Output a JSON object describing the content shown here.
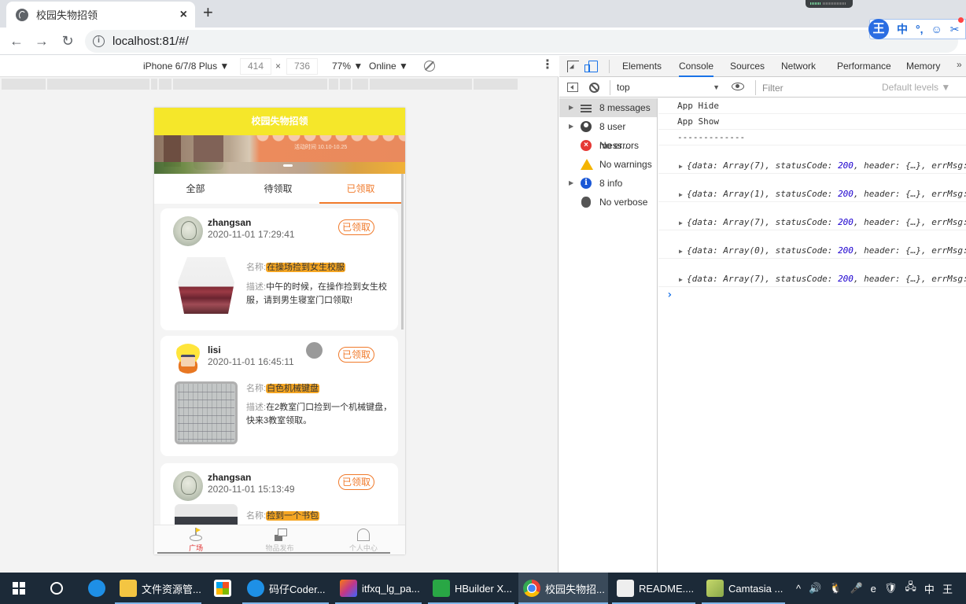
{
  "browser": {
    "tab_title": "校园失物招领",
    "tab_close": "×",
    "new_tab": "+",
    "back": "←",
    "forward": "→",
    "reload": "↻",
    "info_icon": "i",
    "url": "localhost:81/#/"
  },
  "ime_toolbar": {
    "logo": "王",
    "items": [
      "中",
      "°,",
      "☺",
      "✂"
    ]
  },
  "device_toolbar": {
    "device": "iPhone 6/7/8 Plus ▼",
    "width": "414",
    "times": "×",
    "height": "736",
    "zoom": "77% ▼",
    "network": "Online ▼",
    "more": "⋮"
  },
  "app": {
    "header_title": "校园失物招领",
    "banner_text": "活动时间  10.10-10.25",
    "filter_tabs": [
      {
        "label": "全部",
        "active": false
      },
      {
        "label": "待领取",
        "active": false
      },
      {
        "label": "已领取",
        "active": true
      }
    ],
    "name_label": "名称:",
    "desc_label": "描述:",
    "posts": [
      {
        "user": "zhangsan",
        "time": "2020-11-01 17:29:41",
        "status": "已领取",
        "name": "在操场捡到女生校服",
        "desc": "中午的时候，在操作捡到女生校服，请到男生寝室门口领取!"
      },
      {
        "user": "lisi",
        "time": "2020-11-01 16:45:11",
        "status": "已领取",
        "name": "白色机械键盘",
        "desc": "在2教室门口捡到一个机械键盘，快来3教室领取。"
      },
      {
        "user": "zhangsan",
        "time": "2020-11-01 15:13:49",
        "status": "已领取",
        "name": "捡到一个书包",
        "desc": ""
      }
    ],
    "bottom_tabs": [
      {
        "label": "广场",
        "active": true
      },
      {
        "label": "物品发布",
        "active": false
      },
      {
        "label": "个人中心",
        "active": false
      }
    ],
    "accent_color": "#f07a2b",
    "header_color": "#f5e72a"
  },
  "devtools": {
    "tabs": [
      {
        "label": "Elements",
        "active": false
      },
      {
        "label": "Console",
        "active": true
      },
      {
        "label": "Sources",
        "active": false
      },
      {
        "label": "Network",
        "active": false
      },
      {
        "label": "Performance",
        "active": false
      },
      {
        "label": "Memory",
        "active": false
      }
    ],
    "more_tabs": "»",
    "context": "top",
    "context_arrow": "▼",
    "filter_placeholder": "Filter",
    "levels": "Default levels ▼",
    "sidebar": [
      {
        "label": "8 messages",
        "icon": "list-icon",
        "expandable": true
      },
      {
        "label": "8 user mess...",
        "icon": "user-icon",
        "expandable": true
      },
      {
        "label": "No errors",
        "icon": "error-icon",
        "expandable": false
      },
      {
        "label": "No warnings",
        "icon": "warning-icon",
        "expandable": false
      },
      {
        "label": "8 info",
        "icon": "info-icon",
        "expandable": true
      },
      {
        "label": "No verbose",
        "icon": "bug-icon",
        "expandable": false
      }
    ],
    "logs": [
      {
        "text": "App Hide"
      },
      {
        "text": "App Show"
      },
      {
        "text": "-------------"
      }
    ],
    "objects": [
      {
        "pre": "{data: Array(7), statusCode: ",
        "code": "200",
        "post": ", header: {…}, errMsg:"
      },
      {
        "pre": "{data: Array(1), statusCode: ",
        "code": "200",
        "post": ", header: {…}, errMsg:"
      },
      {
        "pre": "{data: Array(7), statusCode: ",
        "code": "200",
        "post": ", header: {…}, errMsg:"
      },
      {
        "pre": "{data: Array(0), statusCode: ",
        "code": "200",
        "post": ", header: {…}, errMsg:"
      },
      {
        "pre": "{data: Array(7), statusCode: ",
        "code": "200",
        "post": ", header: {…}, errMsg:"
      }
    ],
    "prompt": "›"
  },
  "taskbar": {
    "apps": [
      {
        "label": "文件资源管...",
        "icon": "folder-icon",
        "color": "#f4c542"
      },
      {
        "label": "",
        "icon": "store-icon",
        "color": "#ffffff"
      },
      {
        "label": "码仔Coder...",
        "icon": "ie-icon",
        "color": "#1e90e6"
      },
      {
        "label": "itfxq_lg_pa...",
        "icon": "intellij-icon",
        "color": "#c2378a"
      },
      {
        "label": "HBuilder X...",
        "icon": "hbuilder-icon",
        "color": "#29a745"
      },
      {
        "label": "校园失物招...",
        "icon": "chrome-icon",
        "color": "#e8453c"
      },
      {
        "label": "README....",
        "icon": "typora-icon",
        "color": "#eeeeee"
      },
      {
        "label": "Camtasia ...",
        "icon": "camtasia-icon",
        "color": "#a5c25a"
      }
    ],
    "tray": [
      "^",
      "🔊",
      "🐧",
      "🎤",
      "e",
      "🛡",
      "🖧",
      "中",
      "王"
    ]
  }
}
